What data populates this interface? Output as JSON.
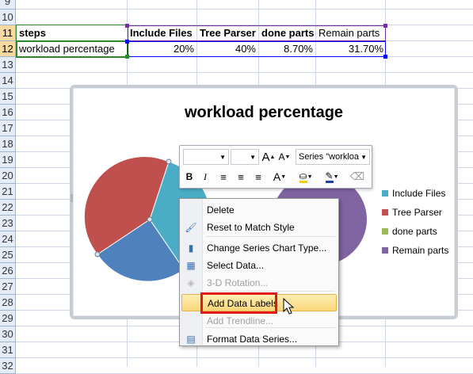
{
  "sheet": {
    "row_numbers": [
      "9",
      "10",
      "11",
      "12",
      "13",
      "14",
      "15",
      "16",
      "17",
      "18",
      "19",
      "20",
      "21",
      "22",
      "23",
      "24",
      "25",
      "26",
      "27",
      "28",
      "29",
      "30",
      "31",
      "32"
    ],
    "selected_rows": [
      "11",
      "12"
    ],
    "row11": {
      "a": "steps",
      "b": "Include Files",
      "c": "Tree Parser",
      "d": "done parts",
      "e": "Remain parts"
    },
    "row12": {
      "a": "workload percentage",
      "b": "20%",
      "c": "40%",
      "d": "8.70%",
      "e": "31.70%"
    }
  },
  "chart": {
    "title": "workload percentage",
    "legend": [
      {
        "label": "Include Files",
        "color": "#4bacc6"
      },
      {
        "label": "Tree Parser",
        "color": "#c0504d"
      },
      {
        "label": "done parts",
        "color": "#9bbb59"
      },
      {
        "label": "Remain parts",
        "color": "#8064a2"
      }
    ],
    "slice_colors": {
      "blue": "#4f81bd",
      "red": "#c0504d",
      "teal": "#4bacc6",
      "purple": "#8064a2"
    }
  },
  "minibar": {
    "series_select": "Series \"workloa",
    "bold": "B",
    "italic": "I",
    "font_grow": "A",
    "font_shrink": "A",
    "font_color": "A"
  },
  "context_menu": {
    "items": [
      {
        "label": "Delete",
        "icon": "none",
        "disabled": false
      },
      {
        "label": "Reset to Match Style",
        "icon": "reset-style-icon",
        "disabled": false
      },
      {
        "label": "Change Series Chart Type...",
        "icon": "chart-type-icon",
        "disabled": false
      },
      {
        "label": "Select Data...",
        "icon": "select-data-icon",
        "disabled": false
      },
      {
        "label": "3-D Rotation...",
        "icon": "rotation-icon",
        "disabled": true
      },
      {
        "label": "Add Data Labels",
        "icon": "none",
        "disabled": false,
        "highlighted": true
      },
      {
        "label": "Add Trendline...",
        "icon": "none",
        "disabled": true
      },
      {
        "label": "Format Data Series...",
        "icon": "format-series-icon",
        "disabled": false
      }
    ]
  },
  "colors": {
    "highlight_box": "#e01919",
    "selection_green": "#2c8a2c"
  }
}
